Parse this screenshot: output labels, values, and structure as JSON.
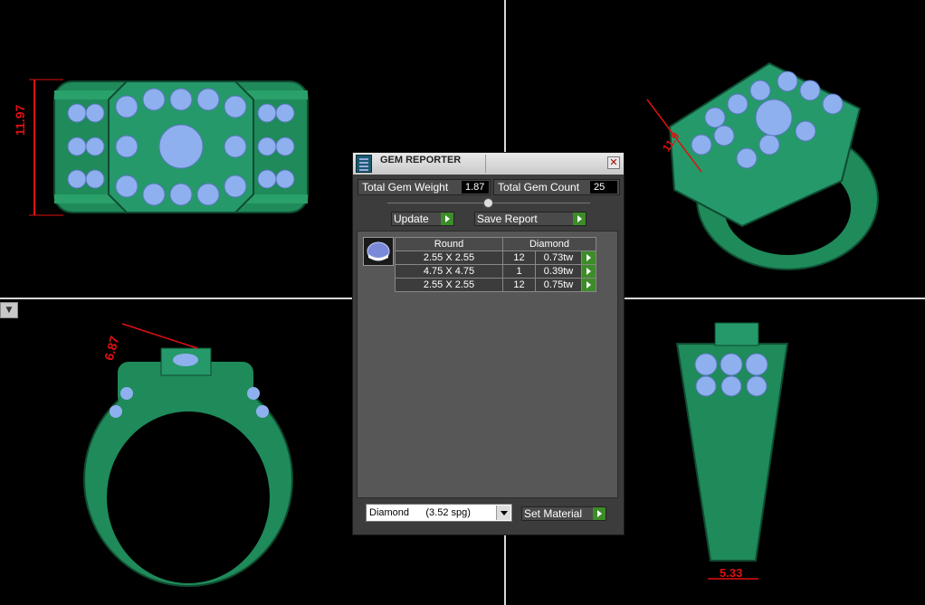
{
  "viewports": {
    "top_left_dim": "11.97",
    "top_right_dim": "11.9",
    "bottom_left_dim": "6.87",
    "bottom_right_dim": "5.33"
  },
  "gem_reporter": {
    "title": "GEM REPORTER",
    "close_glyph": "✕",
    "total_weight_label": "Total Gem Weight",
    "total_weight_value": "1.87",
    "total_count_label": "Total Gem Count",
    "total_count_value": "25",
    "update_label": "Update",
    "save_report_label": "Save Report",
    "columns": [
      "Round",
      "Diamond"
    ],
    "rows": [
      {
        "size": "2.55 X 2.55",
        "count": "12",
        "weight": "0.73tw"
      },
      {
        "size": "4.75 X 4.75",
        "count": "1",
        "weight": "0.39tw"
      },
      {
        "size": "2.55 X 2.55",
        "count": "12",
        "weight": "0.75tw"
      }
    ],
    "material_select": "Diamond      (3.52 spg)",
    "set_material_label": "Set Material"
  },
  "colors": {
    "ring_green": "#1f8a5a",
    "gem_blue": "#8fb0ee",
    "accent_green": "#3c8c28",
    "dimension_red": "#e01010"
  }
}
